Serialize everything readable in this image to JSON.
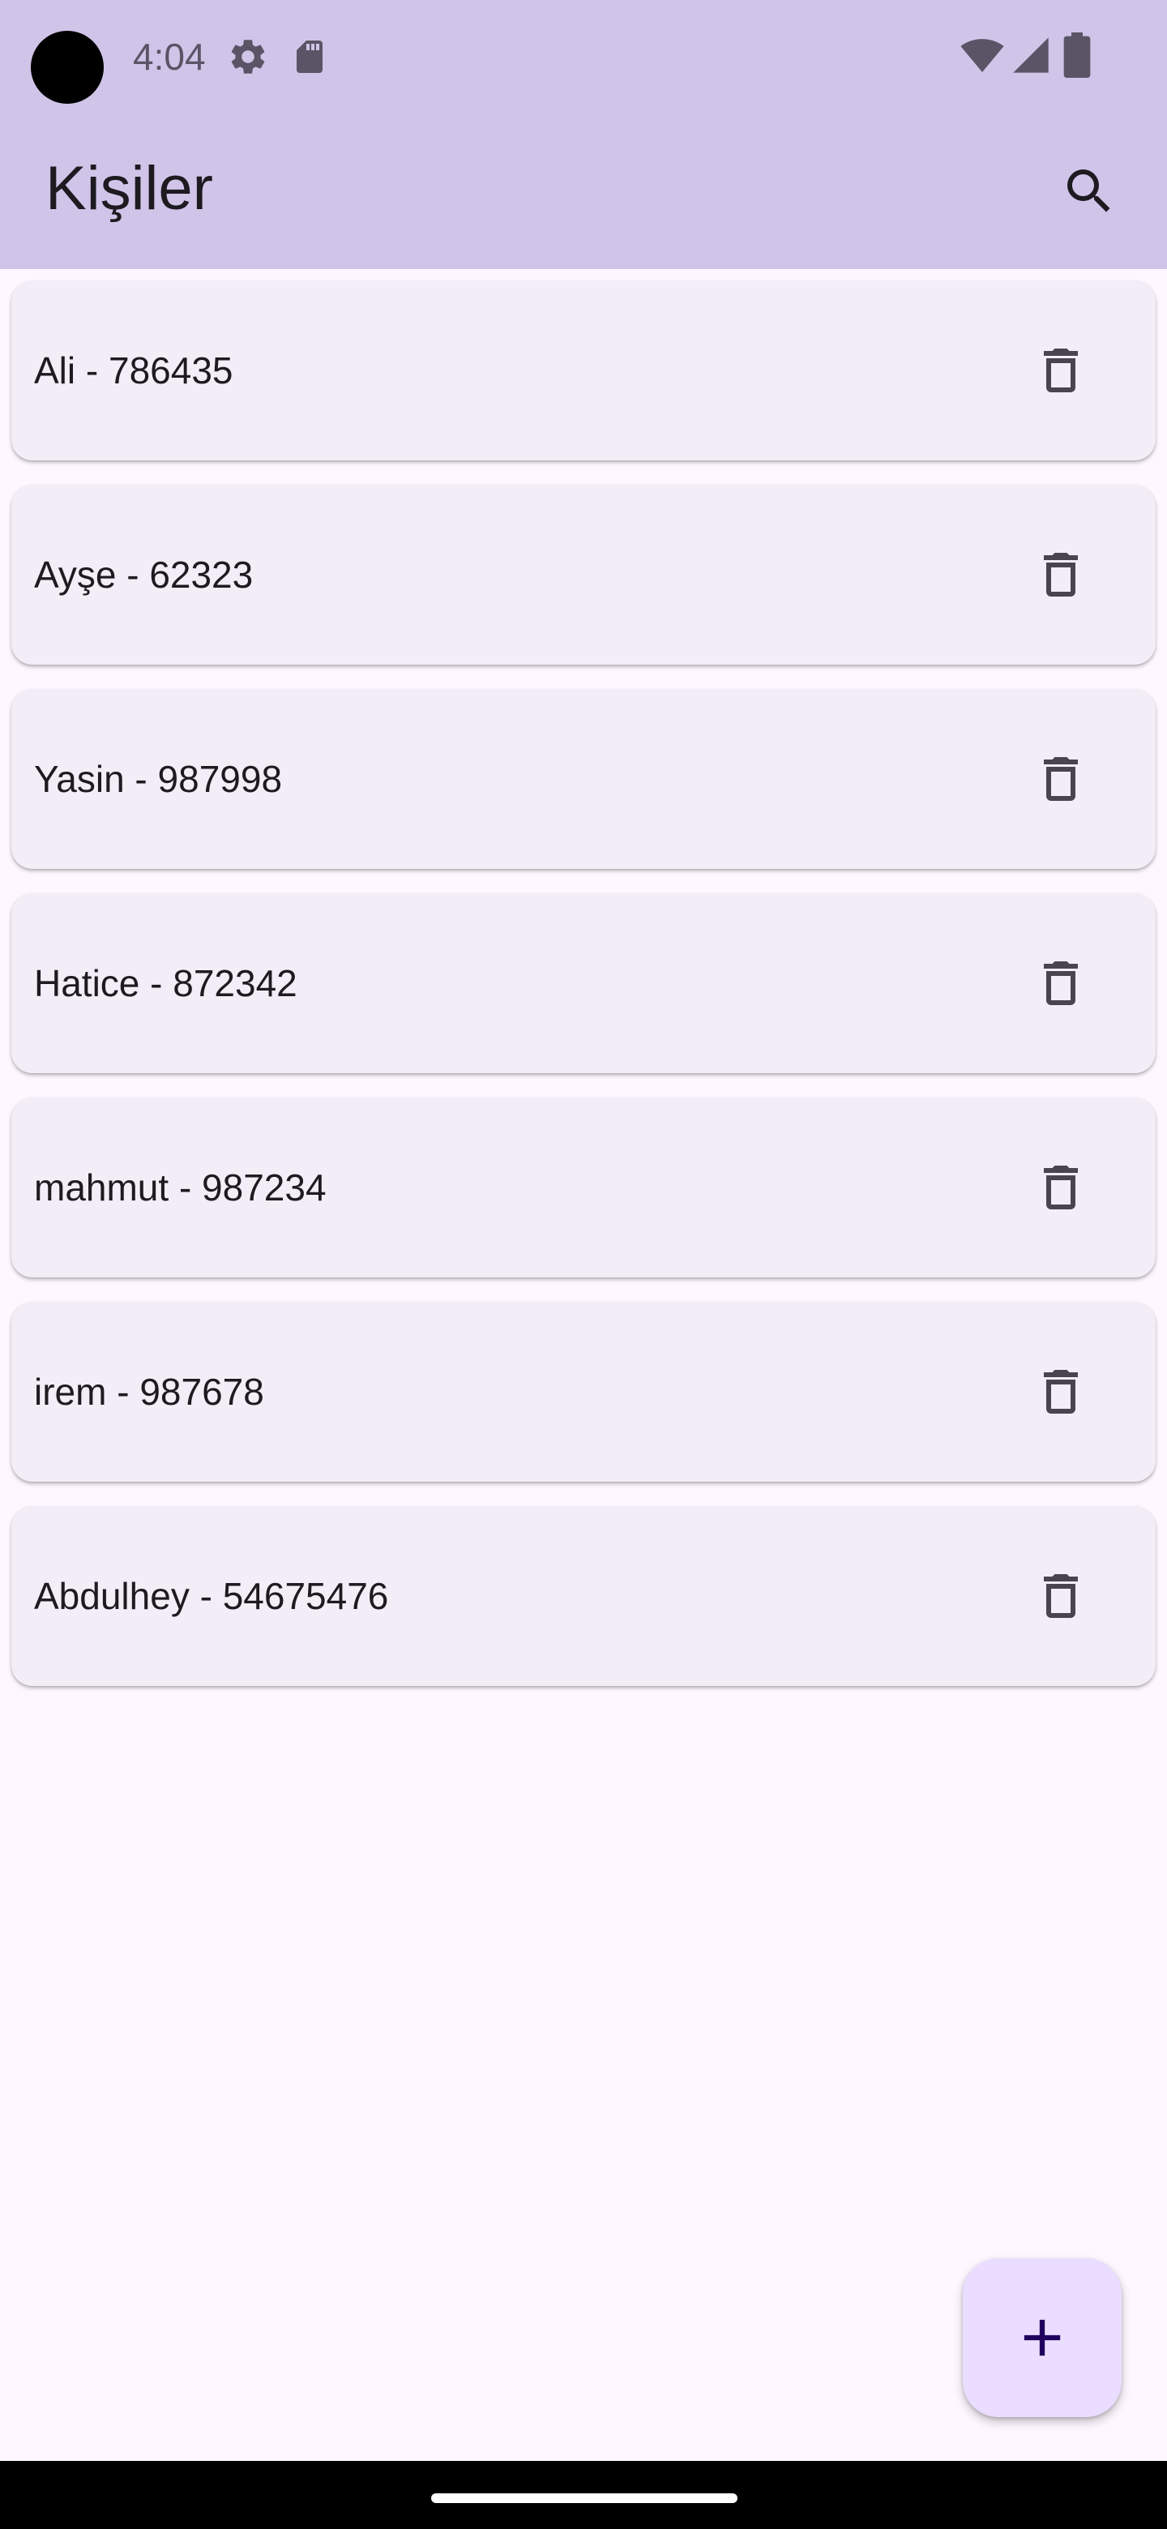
{
  "status_bar": {
    "time": "4:04",
    "icons": [
      "settings-gear-icon",
      "sd-card-icon",
      "wifi-icon",
      "signal-icon",
      "battery-icon"
    ]
  },
  "app_bar": {
    "title": "Kişiler",
    "search_icon": "search-icon"
  },
  "contacts": [
    {
      "label": "Ali - 786435"
    },
    {
      "label": "Ayşe - 62323"
    },
    {
      "label": "Yasin - 987998"
    },
    {
      "label": "Hatice - 872342"
    },
    {
      "label": "mahmut - 987234"
    },
    {
      "label": "irem - 987678"
    },
    {
      "label": "Abdulhey - 54675476"
    }
  ],
  "fab": {
    "icon": "plus-icon"
  },
  "colors": {
    "app_bar": "#D1C4E9",
    "background": "#FEF7FF",
    "card": "#F3EDF7",
    "fab": "#EADDFF",
    "icon": "#49454F",
    "text": "#1D1B20"
  }
}
